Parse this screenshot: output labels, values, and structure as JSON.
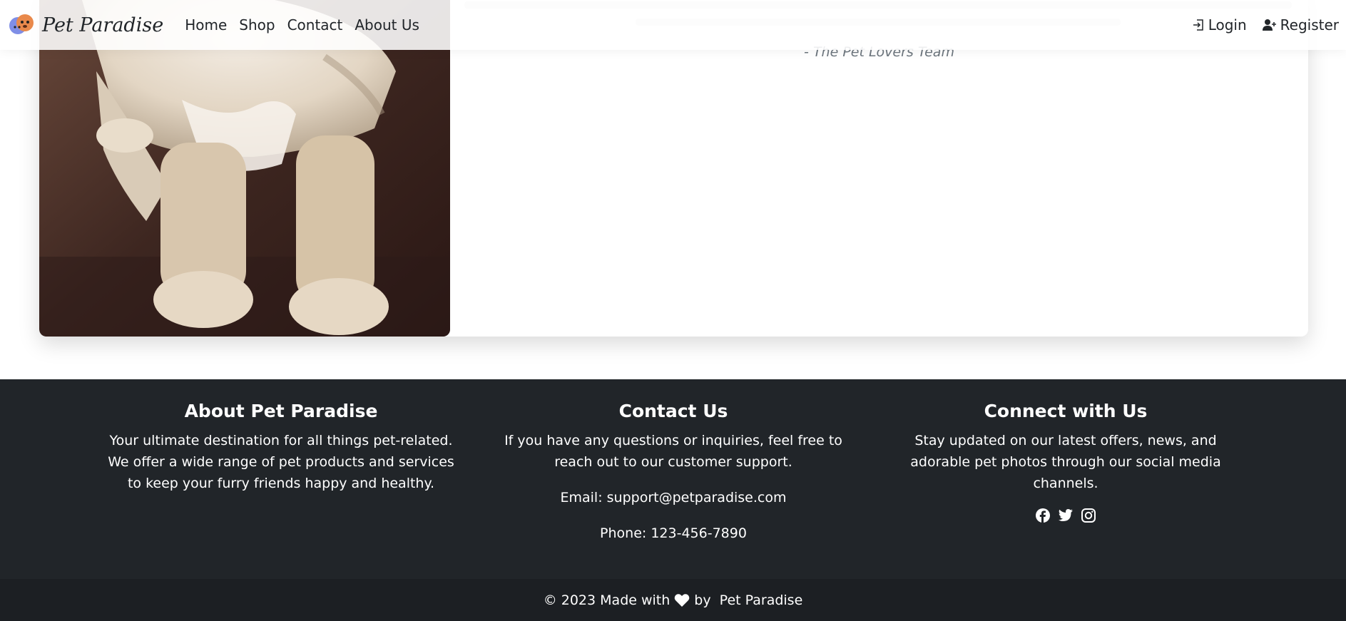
{
  "navbar": {
    "brand": "Pet Paradise",
    "links": [
      "Home",
      "Shop",
      "Contact",
      "About Us"
    ],
    "login": "Login",
    "register": "Register"
  },
  "card": {
    "signature": "- The Pet Lovers Team"
  },
  "footer": {
    "about": {
      "title": "About Pet Paradise",
      "text": "Your ultimate destination for all things pet-related. We offer a wide range of pet products and services to keep your furry friends happy and healthy."
    },
    "contact": {
      "title": "Contact Us",
      "text": "If you have any questions or inquiries, feel free to reach out to our customer support.",
      "email": "Email: support@petparadise.com",
      "phone": "Phone: 123-456-7890"
    },
    "connect": {
      "title": "Connect with Us",
      "text": "Stay updated on our latest offers, news, and adorable pet photos through our social media channels.",
      "icons": [
        "facebook-icon",
        "twitter-icon",
        "instagram-icon"
      ]
    },
    "copyright_prefix": "© 2023 Made with",
    "copyright_suffix": "by  Pet Paradise"
  },
  "colors": {
    "footer_bg": "#212529",
    "copyright_bg": "#1c1f23",
    "text": "#212529",
    "muted": "#6c757d"
  }
}
